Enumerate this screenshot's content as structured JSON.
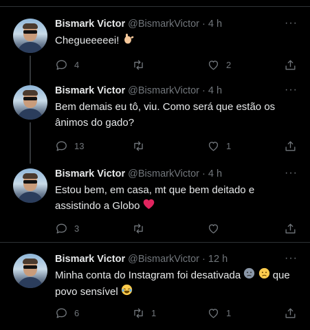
{
  "tweets": [
    {
      "name": "Bismark Victor",
      "handle": "@BismarkVictor",
      "dot": "·",
      "time": "4 h",
      "text": "Chegueeeeei!",
      "emoji": "wave-hand",
      "replies": "4",
      "retweets": "",
      "likes": "2"
    },
    {
      "name": "Bismark Victor",
      "handle": "@BismarkVictor",
      "dot": "·",
      "time": "4 h",
      "text": "Bem demais eu tô, viu. Como será que estão os ânimos do gado?",
      "replies": "13",
      "retweets": "",
      "likes": "1"
    },
    {
      "name": "Bismark Victor",
      "handle": "@BismarkVictor",
      "dot": "·",
      "time": "4 h",
      "text": "Estou bem, em casa, mt que bem deitado e assistindo a Globo",
      "emoji": "red-heart",
      "replies": "3",
      "retweets": "",
      "likes": ""
    },
    {
      "name": "Bismark Victor",
      "handle": "@BismarkVictor",
      "dot": "·",
      "time": "12 h",
      "text_before": "Minha conta do Instagram foi desativada",
      "text_after": "que povo sensível",
      "emoji": "frowning-faces, laughing-tears",
      "replies": "6",
      "retweets": "1",
      "likes": "1"
    }
  ],
  "more_label": "···",
  "colors": {
    "background": "#000000",
    "text": "#e7e9ea",
    "muted": "#71767b",
    "heart": "#f91880"
  }
}
